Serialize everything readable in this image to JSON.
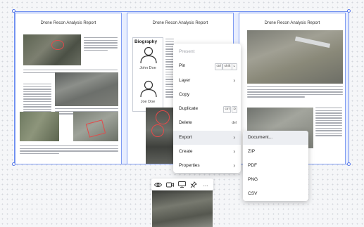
{
  "pages": [
    {
      "title": "Drone Recon Analysis Report"
    },
    {
      "title": "Drone Recon Analysis Report",
      "biography_heading": "Biography",
      "person_1": "John Doe",
      "person_2": "Joe Doe"
    },
    {
      "title": "Drone Recon Analysis Report"
    }
  ],
  "context_menu": {
    "items": [
      {
        "label": "Present",
        "disabled": true
      },
      {
        "label": "Pin",
        "shortcut": [
          "ctrl",
          "shift",
          "L"
        ]
      },
      {
        "label": "Layer",
        "has_submenu": true
      },
      {
        "label": "Copy"
      },
      {
        "label": "Duplicate",
        "shortcut": [
          "ctrl",
          "D"
        ]
      },
      {
        "label": "Delete",
        "hint": "del"
      },
      {
        "label": "Export",
        "has_submenu": true,
        "active": true
      },
      {
        "label": "Create",
        "has_submenu": true
      },
      {
        "label": "Properties",
        "has_submenu": true
      }
    ]
  },
  "export_submenu": {
    "items": [
      {
        "label": "Document..."
      },
      {
        "label": "ZIP"
      },
      {
        "label": "PDF"
      },
      {
        "label": "PNG"
      },
      {
        "label": "CSV"
      }
    ]
  },
  "toolbar": {
    "icons": [
      "eye-icon",
      "video-icon",
      "monitor-icon",
      "pin-icon",
      "more-icon"
    ],
    "more_label": "..."
  },
  "colors": {
    "selection": "#6f8ff0",
    "highlight_circle": "#e34a4a",
    "menu_active": "#eceef2"
  }
}
